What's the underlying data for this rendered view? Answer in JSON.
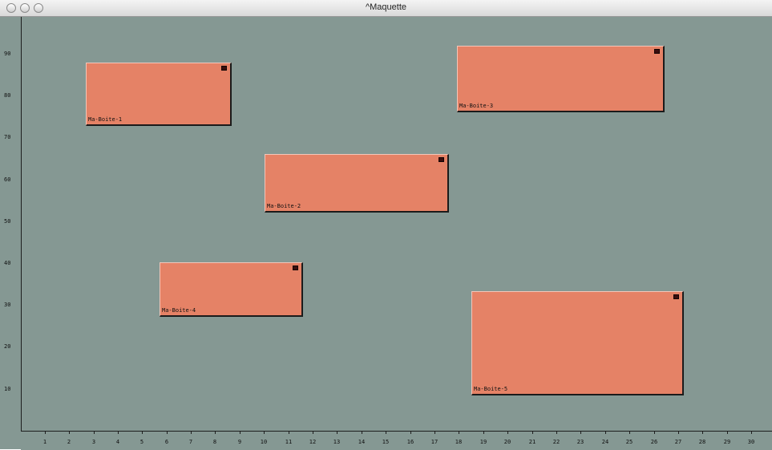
{
  "window": {
    "title": "^Maquette"
  },
  "ruler": {
    "vertical_labels": [
      "90",
      "80",
      "70",
      "60",
      "50",
      "40",
      "30",
      "20",
      "10"
    ],
    "horizontal_labels": [
      "1",
      "2",
      "3",
      "4",
      "5",
      "6",
      "7",
      "8",
      "9",
      "10",
      "11",
      "12",
      "13",
      "14",
      "15",
      "16",
      "17",
      "18",
      "19",
      "20",
      "21",
      "22",
      "23",
      "24",
      "25",
      "26",
      "27",
      "28",
      "29",
      "30"
    ]
  },
  "boxes": [
    {
      "label": "Ma-Boite-1"
    },
    {
      "label": "Ma-Boite-2"
    },
    {
      "label": "Ma-Boite-3"
    },
    {
      "label": "Ma-Boite-4"
    },
    {
      "label": "Ma-Boite-5"
    }
  ],
  "colors": {
    "canvas": "#859893",
    "box_fill": "#e58266"
  }
}
